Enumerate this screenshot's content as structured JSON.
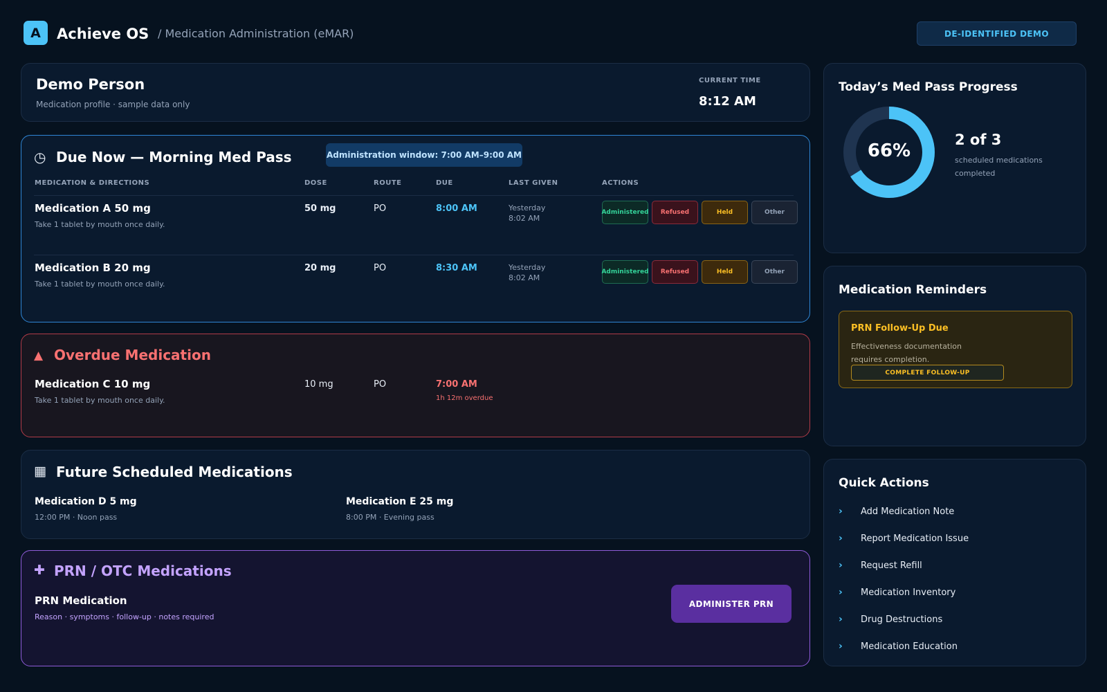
{
  "header": {
    "logo_letter": "A",
    "app_title": "Achieve OS",
    "breadcrumb": "/ Medication Administration (eMAR)",
    "badge": "DE-IDENTIFIED DEMO"
  },
  "person": {
    "name": "Demo Person",
    "subtitle": "Medication profile · sample data only",
    "time_label": "CURRENT TIME",
    "time_value": "8:12 AM"
  },
  "due_now": {
    "icon": "clock-icon",
    "icon_glyph": "◷",
    "title": "Due Now — Morning Med Pass",
    "window": "Administration window: 7:00 AM–9:00 AM",
    "columns": [
      "MEDICATION & DIRECTIONS",
      "DOSE",
      "ROUTE",
      "DUE",
      "LAST GIVEN",
      "ACTIONS"
    ],
    "actions": [
      "Administered",
      "Refused",
      "Held",
      "Other"
    ],
    "rows": [
      {
        "name": "Medication A 50 mg",
        "directions": "Take 1 tablet by mouth once daily.",
        "dose": "50 mg",
        "route": "PO",
        "due": "8:00 AM",
        "last_given_day": "Yesterday",
        "last_given_time": "8:02 AM"
      },
      {
        "name": "Medication B 20 mg",
        "directions": "Take 1 tablet by mouth once daily.",
        "dose": "20 mg",
        "route": "PO",
        "due": "8:30 AM",
        "last_given_day": "Yesterday",
        "last_given_time": "8:02 AM"
      }
    ]
  },
  "overdue": {
    "icon": "warning-icon",
    "icon_glyph": "▲",
    "title": "Overdue Medication",
    "row": {
      "name": "Medication C 10 mg",
      "directions": "Take 1 tablet by mouth once daily.",
      "dose": "10 mg",
      "route": "PO",
      "due": "7:00 AM",
      "overdue_note": "1h 12m overdue"
    }
  },
  "future": {
    "icon": "calendar-icon",
    "icon_glyph": "▦",
    "title": "Future Scheduled Medications",
    "items": [
      {
        "name": "Medication D 5 mg",
        "schedule": "12:00 PM · Noon pass"
      },
      {
        "name": "Medication E 25 mg",
        "schedule": "8:00 PM · Evening pass"
      }
    ]
  },
  "prn": {
    "icon": "plus-icon",
    "icon_glyph": "✚",
    "title": "PRN / OTC Medications",
    "name": "PRN Medication",
    "subtitle": "Reason · symptoms · follow-up · notes required",
    "button": "ADMINISTER PRN"
  },
  "progress": {
    "title": "Today’s Med Pass Progress",
    "percent": 66,
    "percent_label": "66%",
    "count": "2 of 3",
    "count_sub": "scheduled medications completed",
    "ring_color": "#4cc3f7",
    "track_color": "#1f3450"
  },
  "reminders": {
    "title": "Medication Reminders",
    "item": {
      "title": "PRN Follow-Up Due",
      "text": "Effectiveness documentation requires completion.",
      "button": "COMPLETE FOLLOW-UP"
    }
  },
  "quick_actions": {
    "title": "Quick Actions",
    "chevron": "›",
    "items": [
      "Add Medication Note",
      "Report Medication Issue",
      "Request Refill",
      "Medication Inventory",
      "Drug Destructions",
      "Medication Education"
    ]
  }
}
